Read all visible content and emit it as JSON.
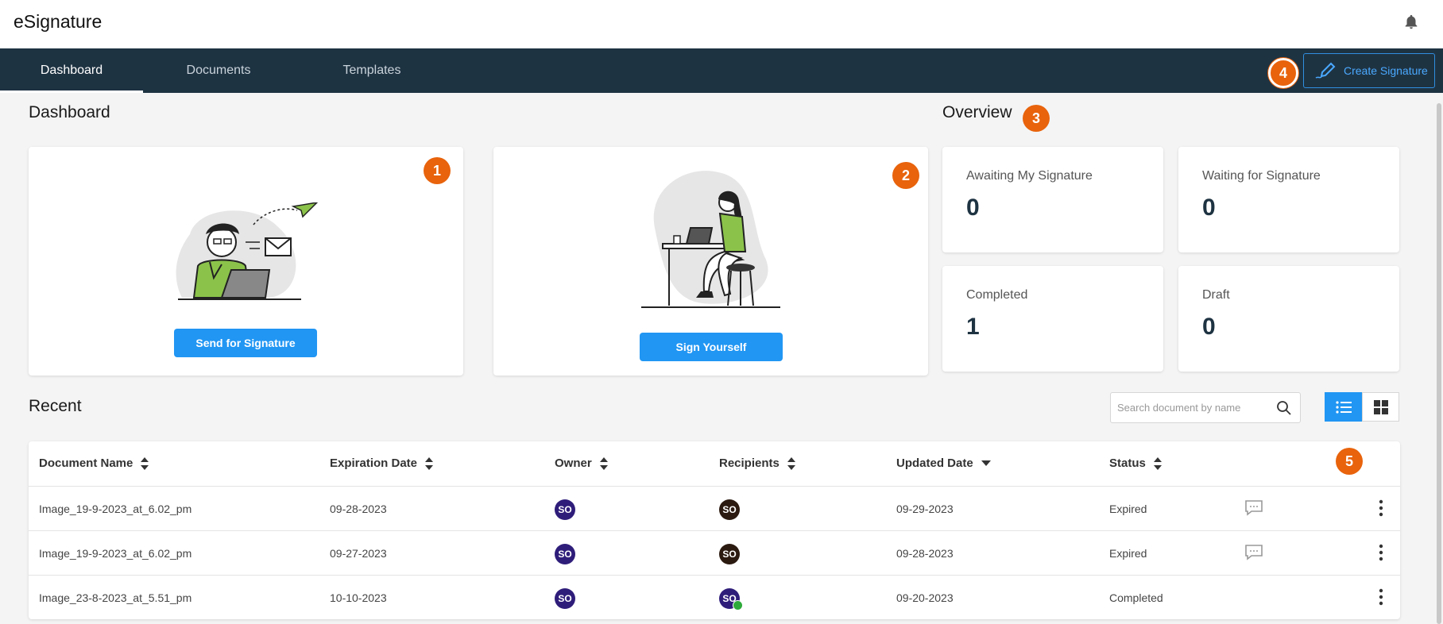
{
  "app": {
    "title": "eSignature"
  },
  "nav": {
    "tabs": [
      {
        "label": "Dashboard",
        "active": true
      },
      {
        "label": "Documents",
        "active": false
      },
      {
        "label": "Templates",
        "active": false
      }
    ],
    "create_label": "Create Signature"
  },
  "badges": [
    "1",
    "2",
    "3",
    "4",
    "5"
  ],
  "dashboard": {
    "title": "Dashboard",
    "send_label": "Send for Signature",
    "sign_label": "Sign Yourself"
  },
  "overview": {
    "title": "Overview",
    "stats": [
      {
        "label": "Awaiting My Signature",
        "value": "0"
      },
      {
        "label": "Waiting for Signature",
        "value": "0"
      },
      {
        "label": "Completed",
        "value": "1"
      },
      {
        "label": "Draft",
        "value": "0"
      }
    ]
  },
  "recent": {
    "title": "Recent",
    "search_placeholder": "Search document by name",
    "columns": [
      "Document Name",
      "Expiration Date",
      "Owner",
      "Recipients",
      "Updated Date",
      "Status"
    ],
    "rows": [
      {
        "name": "Image_19-9-2023_at_6.02_pm",
        "expiration": "09-28-2023",
        "owner": "SO",
        "recipient": "SO",
        "updated": "09-29-2023",
        "status": "Expired"
      },
      {
        "name": "Image_19-9-2023_at_6.02_pm",
        "expiration": "09-27-2023",
        "owner": "SO",
        "recipient": "SO",
        "updated": "09-28-2023",
        "status": "Expired"
      },
      {
        "name": "Image_23-8-2023_at_5.51_pm",
        "expiration": "10-10-2023",
        "owner": "SO",
        "recipient": "SO",
        "updated": "09-20-2023",
        "status": "Completed"
      }
    ]
  },
  "colors": {
    "navbar": "#1e3342",
    "accent": "#2196f3",
    "badge": "#e8630c",
    "owner_avatar": "#2f1d7a",
    "recipient_avatar": "#2b1a10",
    "completed_check": "#2eaa3a"
  },
  "icons": [
    "bell-icon",
    "pen-icon",
    "search-icon",
    "list-view-icon",
    "grid-view-icon",
    "sort-icon",
    "sort-down-icon",
    "comment-icon",
    "kebab-menu-icon",
    "check-icon"
  ]
}
